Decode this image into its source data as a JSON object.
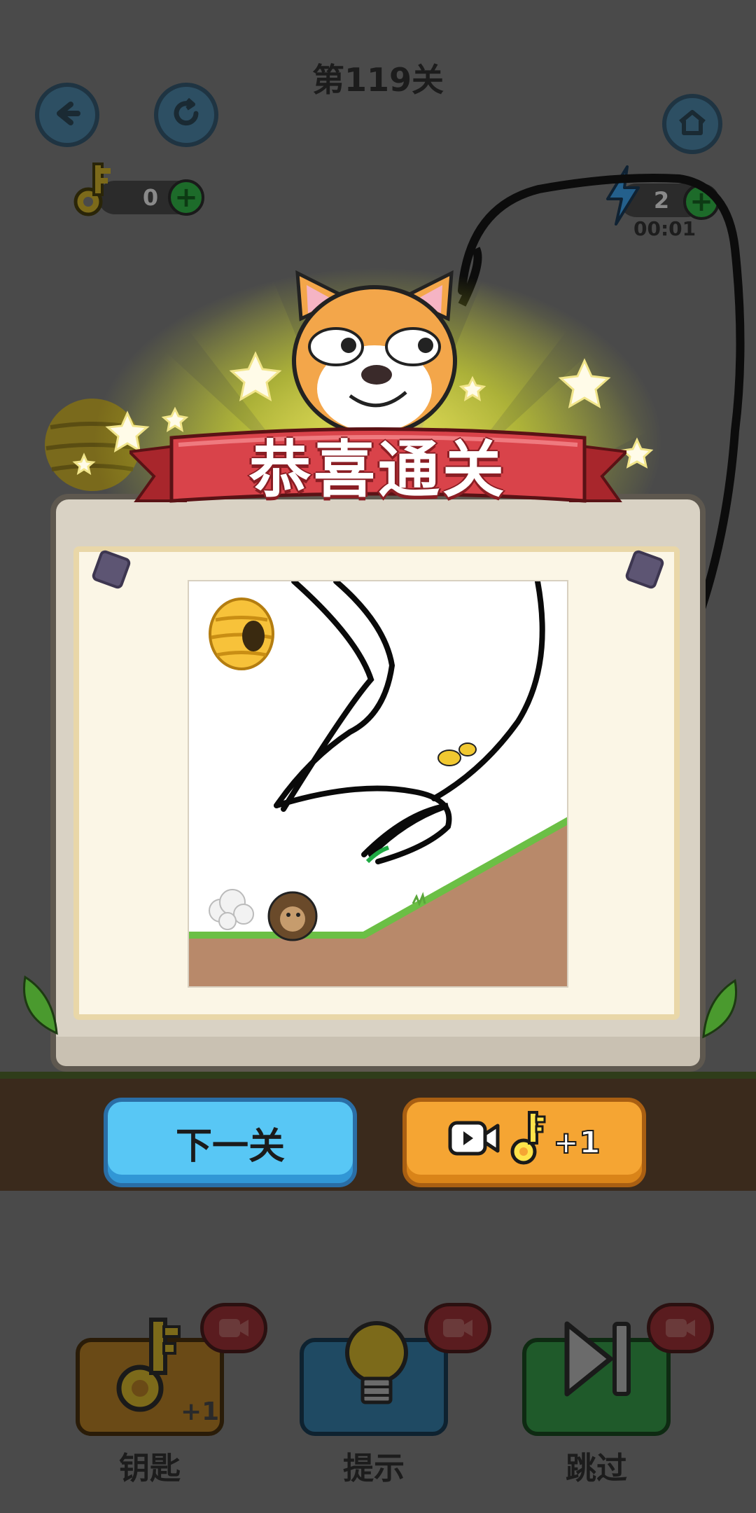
{
  "header": {
    "level_title": "第119关"
  },
  "resources": {
    "keys": "0",
    "energy": "2",
    "timer": "00:01"
  },
  "popup": {
    "banner_text": "恭喜通关",
    "next_button": "下一关",
    "key_reward": "+1"
  },
  "tools": [
    {
      "label": "钥匙",
      "badge": "+1",
      "color": "#6a4a16"
    },
    {
      "label": "提示",
      "color": "#1f4a63"
    },
    {
      "label": "跳过",
      "color": "#1f5a2a"
    }
  ],
  "colors": {
    "banner": "#d9434a",
    "next_button": "#58c7f5",
    "key_button": "#f5a533"
  }
}
